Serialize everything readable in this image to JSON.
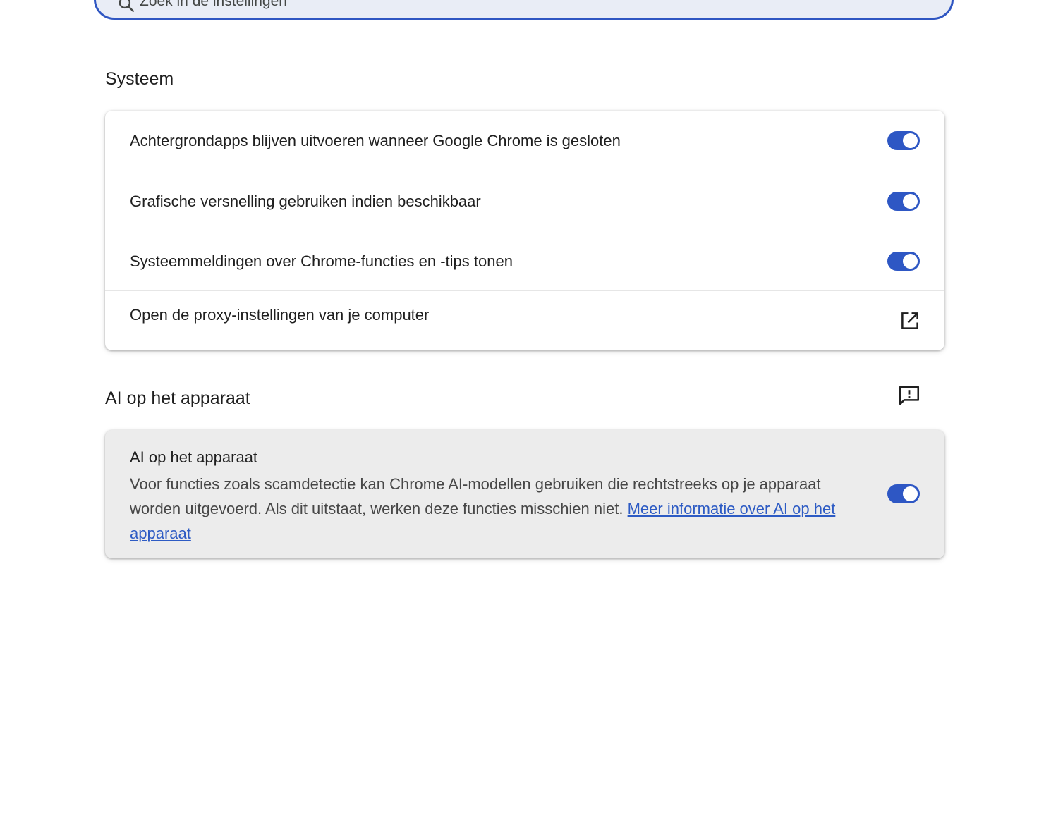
{
  "search": {
    "placeholder": "Zoek in de instellingen"
  },
  "system_section": {
    "title": "Systeem",
    "rows": [
      {
        "label": "Achtergrondapps blijven uitvoeren wanneer Google Chrome is gesloten",
        "toggle_on": true
      },
      {
        "label": "Grafische versnelling gebruiken indien beschikbaar",
        "toggle_on": true
      },
      {
        "label": "Systeemmeldingen over Chrome-functies en -tips tonen",
        "toggle_on": true
      },
      {
        "label": "Open de proxy-instellingen van je computer",
        "icon": "open-in-new-icon"
      }
    ]
  },
  "ai_section": {
    "title": "AI op het apparaat",
    "feedback_icon": "feedback-icon",
    "setting": {
      "title": "AI op het apparaat",
      "description": "Voor functies zoals scamdetectie kan Chrome AI-modellen gebruiken die rechtstreeks op je apparaat worden uitgevoerd. Als dit uitstaat, werken deze functies misschien niet.",
      "link_text": "Meer informatie over AI op het apparaat",
      "toggle_on": true
    }
  },
  "colors": {
    "accent": "#2e57c4",
    "link": "#2d5bc4",
    "search_border": "#2f56c2",
    "search_bg": "#e9edf6",
    "highlight_card_bg": "#ececec"
  }
}
